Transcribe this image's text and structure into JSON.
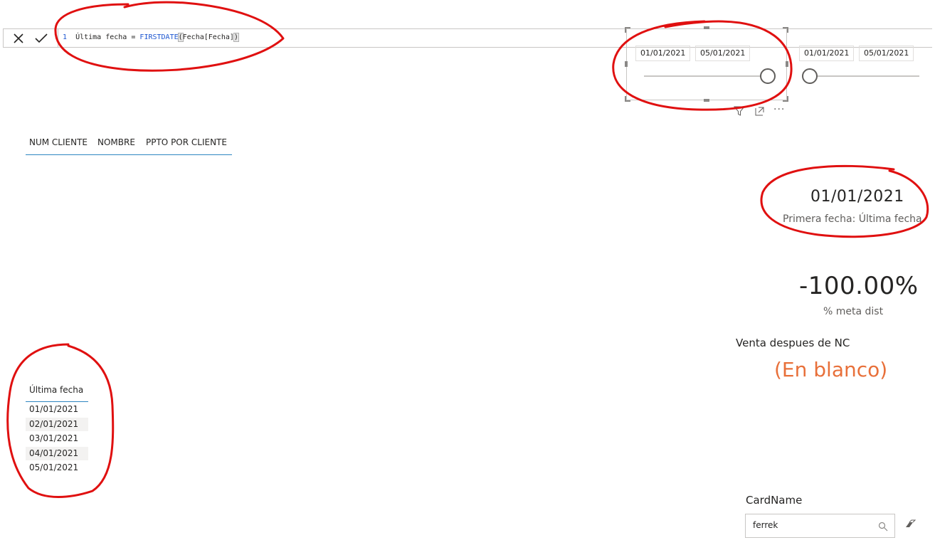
{
  "formula": {
    "line_number": "1",
    "measure_name": "Última fecha",
    "operator": "=",
    "function": "FIRSTDATE",
    "open_paren": "(",
    "argument": "Fecha[Fecha]",
    "close_paren": ")"
  },
  "slicers": [
    {
      "start": "01/01/2021",
      "end": "05/01/2021"
    },
    {
      "start": "01/01/2021",
      "end": "05/01/2021"
    }
  ],
  "visual_toolbar": {
    "more": "···"
  },
  "table": {
    "columns": [
      "NUM CLIENTE",
      "NOMBRE",
      "PPTO POR CLIENTE"
    ]
  },
  "card_date": {
    "value": "01/01/2021",
    "label": "Primera fecha: Última fecha"
  },
  "card_pct": {
    "value": "-100.00%",
    "label": "% meta dist"
  },
  "card_sales": {
    "title": "Venta despues de NC",
    "value": "(En blanco)",
    "value_color": "#E8703A"
  },
  "list": {
    "header": "Última fecha",
    "items": [
      "01/01/2021",
      "02/01/2021",
      "03/01/2021",
      "04/01/2021",
      "05/01/2021"
    ]
  },
  "search": {
    "title": "CardName",
    "value": "ferrek"
  },
  "colors": {
    "annotation": "#E01010",
    "accent_underline": "#2E86C1"
  }
}
